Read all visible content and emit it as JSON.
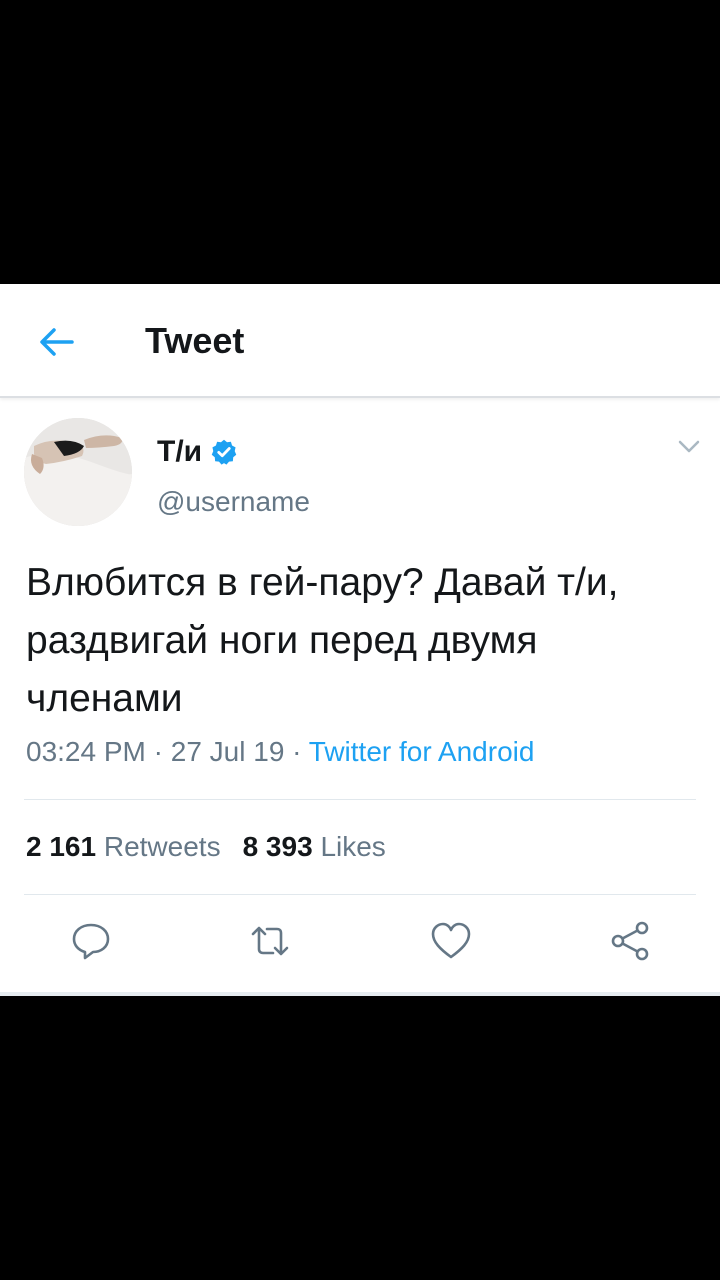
{
  "header": {
    "back_icon": "arrow-left-icon",
    "title": "Tweet"
  },
  "tweet": {
    "display_name": "Т/и",
    "handle": "@username",
    "verified_icon": "verified-badge-icon",
    "text": "Влюбится в гей-пару? Давай т/и, раздвигай ноги перед двумя членами",
    "time": "03:24 PM",
    "separator": "·",
    "date": "27 Jul 19",
    "source": "Twitter for Android"
  },
  "stats": {
    "retweets_count": "2 161",
    "retweets_label": "Retweets",
    "likes_count": "8 393",
    "likes_label": "Likes"
  },
  "actions": [
    "reply-icon",
    "retweet-icon",
    "like-icon",
    "share-icon"
  ],
  "colors": {
    "accent": "#1da1f2",
    "text_primary": "#14171a",
    "text_secondary": "#657786"
  }
}
